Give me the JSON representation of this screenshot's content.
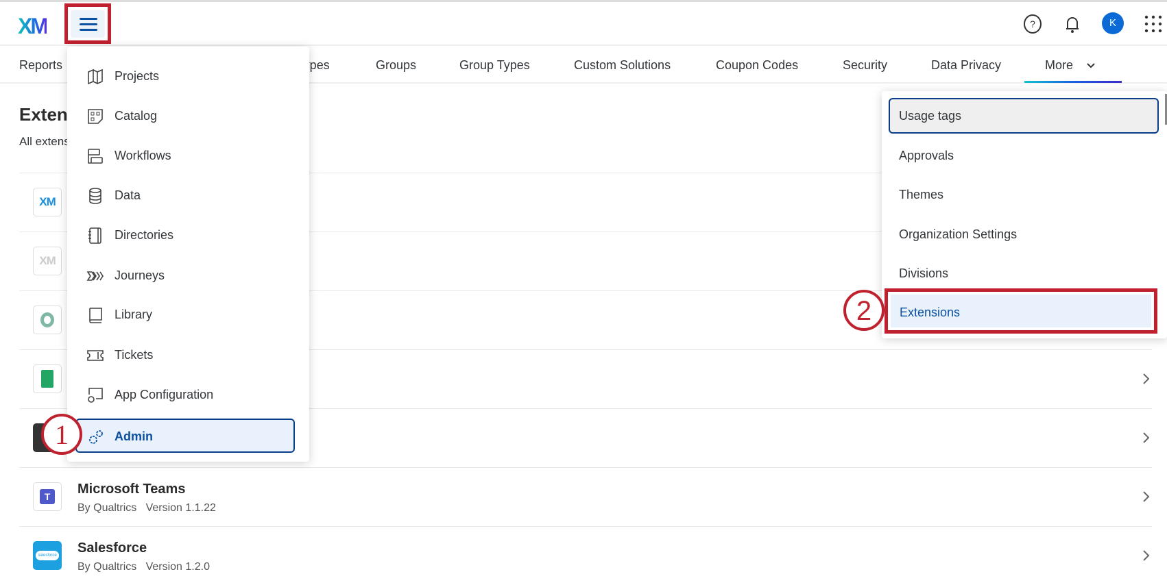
{
  "header": {
    "logo": "XM",
    "avatar_initial": "K",
    "icons": [
      "help-icon",
      "bell-icon",
      "apps-grid-icon"
    ]
  },
  "tabs": [
    "Reports",
    "User Types",
    "Groups",
    "Group Types",
    "Custom Solutions",
    "Coupon Codes",
    "Security",
    "Data Privacy",
    "More"
  ],
  "page": {
    "title": "Extensions",
    "subtitle": "All extensions"
  },
  "extensions": [
    {
      "name": "",
      "sub": "",
      "icon": "xm-icon"
    },
    {
      "name": "",
      "sub": "",
      "icon": "xm-gray-icon"
    },
    {
      "name": "",
      "sub": "",
      "icon": "ring-icon"
    },
    {
      "name": "",
      "sub": "",
      "icon": "google-sheets-icon"
    },
    {
      "name": "",
      "sub": "",
      "icon": "dark-app-icon"
    },
    {
      "name": "Microsoft Teams",
      "sub": "By Qualtrics   Version 1.1.22",
      "icon": "teams-icon"
    },
    {
      "name": "Salesforce",
      "sub": "By Qualtrics   Version 1.2.0",
      "icon": "salesforce-icon",
      "icon_text": "salesforce"
    }
  ],
  "nav_menu": [
    "Projects",
    "Catalog",
    "Workflows",
    "Data",
    "Directories",
    "Journeys",
    "Library",
    "Tickets",
    "App Configuration",
    "Admin"
  ],
  "more_menu": [
    "Usage tags",
    "Approvals",
    "Themes",
    "Organization Settings",
    "Divisions",
    "Extensions"
  ],
  "annotations": {
    "step1": "1",
    "step2": "2",
    "color": "#c0212e"
  }
}
